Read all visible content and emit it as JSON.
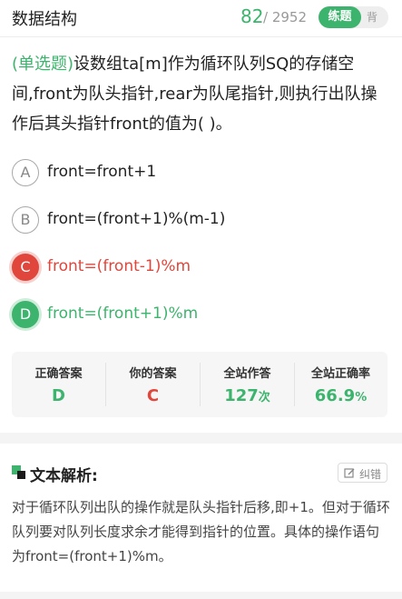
{
  "header": {
    "title": "数据结构",
    "progress_current": "82",
    "progress_total": "/ 2952",
    "mode_practice": "练题",
    "mode_recite": "背"
  },
  "question": {
    "type_tag": "(单选题)",
    "text": "设数组ta[m]作为循环队列SQ的存储空间,front为队头指针,rear为队尾指针,则执行出队操作后其头指针front的值为(        )。"
  },
  "options": [
    {
      "letter": "A",
      "text": "front=front+1",
      "state": "normal"
    },
    {
      "letter": "B",
      "text": "front=(front+1)%(m-1)",
      "state": "normal"
    },
    {
      "letter": "C",
      "text": "front=(front-1)%m",
      "state": "wrong"
    },
    {
      "letter": "D",
      "text": "front=(front+1)%m",
      "state": "correct"
    }
  ],
  "stats": {
    "correct_answer_label": "正确答案",
    "correct_answer_value": "D",
    "your_answer_label": "你的答案",
    "your_answer_value": "C",
    "attempts_label": "全站作答",
    "attempts_value": "127",
    "attempts_unit": "次",
    "accuracy_label": "全站正确率",
    "accuracy_value": "66.9",
    "accuracy_unit": "%"
  },
  "analysis": {
    "title": "文本解析:",
    "report_button": "纠错",
    "text": "对于循环队列出队的操作就是队头指针后移,即+1。但对于循环队列要对队列长度求余才能得到指针的位置。具体的操作语句为front=(front+1)%m。"
  },
  "colors": {
    "green": "#3db46d",
    "red": "#e0463c"
  }
}
